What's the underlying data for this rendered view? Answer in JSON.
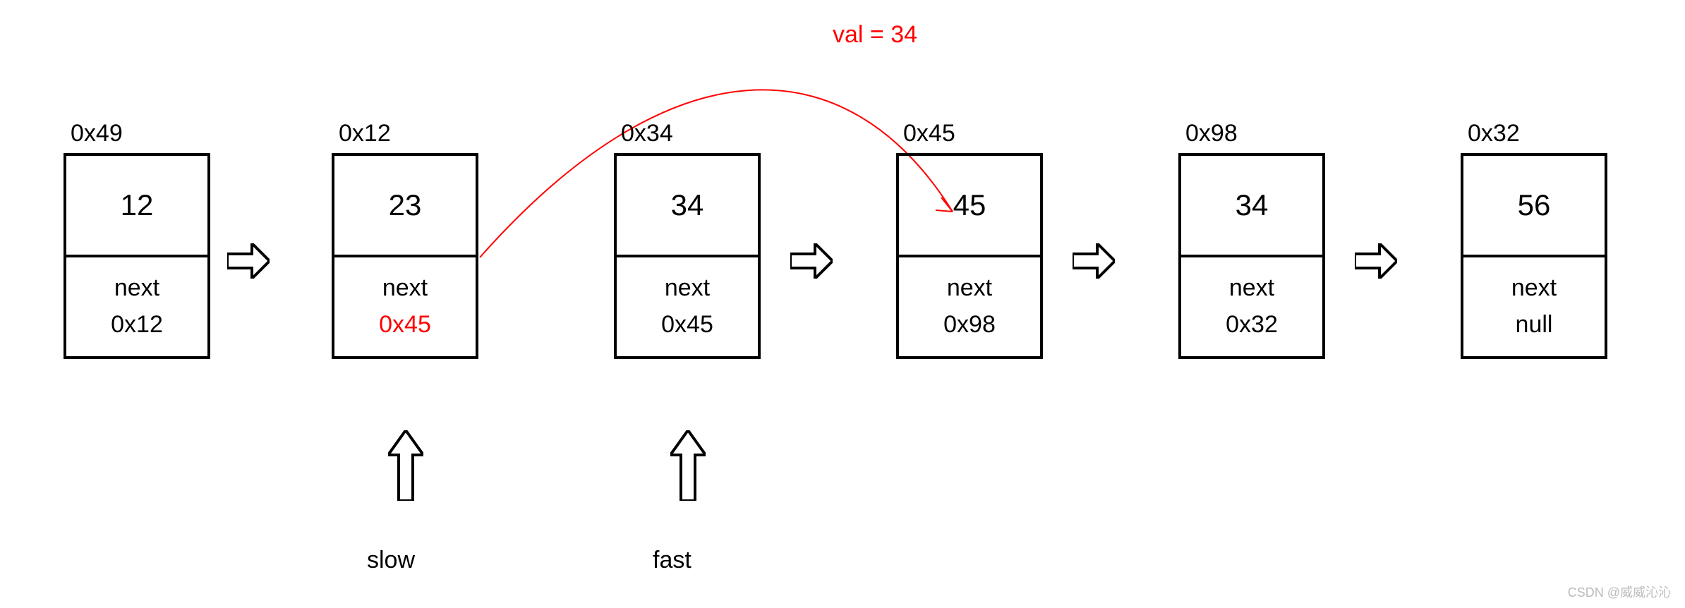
{
  "annotation": "val = 34",
  "nodes": [
    {
      "address": "0x49",
      "val": "12",
      "next_label": "next",
      "next_value": "0x12",
      "highlight_next": false
    },
    {
      "address": "0x12",
      "val": "23",
      "next_label": "next",
      "next_value": "0x45",
      "highlight_next": true
    },
    {
      "address": "0x34",
      "val": "34",
      "next_label": "next",
      "next_value": "0x45",
      "highlight_next": false
    },
    {
      "address": "0x45",
      "val": "45",
      "next_label": "next",
      "next_value": "0x98",
      "highlight_next": false
    },
    {
      "address": "0x98",
      "val": "34",
      "next_label": "next",
      "next_value": "0x32",
      "highlight_next": false
    },
    {
      "address": "0x32",
      "val": "56",
      "next_label": "next",
      "next_value": "null",
      "highlight_next": false
    }
  ],
  "pointers": {
    "slow_label": "slow",
    "fast_label": "fast"
  },
  "watermark": "CSDN @威威沁沁"
}
